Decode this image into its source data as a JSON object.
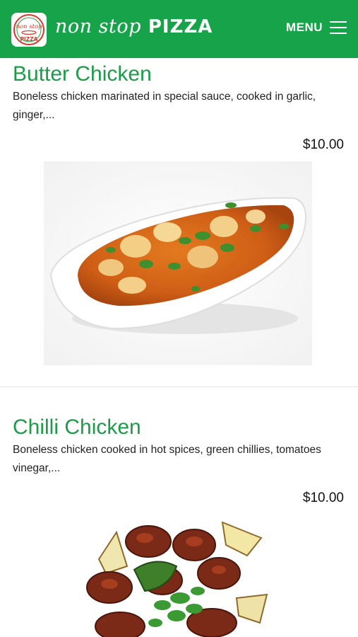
{
  "header": {
    "logo_text_top": "non stop",
    "logo_text_bottom": "PIZZA",
    "brand_script": "non stop",
    "brand_bold": "PIZZA",
    "menu_label": "MENU",
    "background_color": "#17a34a"
  },
  "items": [
    {
      "title": "Butter Chicken",
      "description": "Boneless chicken marinated in special sauce, cooked in garlic, ginger,...",
      "price": "$10.00"
    },
    {
      "title": "Chilli Chicken",
      "description": "Boneless chicken cooked in hot spices, green chillies, tomatoes vinegar,...",
      "price": "$10.00"
    }
  ]
}
